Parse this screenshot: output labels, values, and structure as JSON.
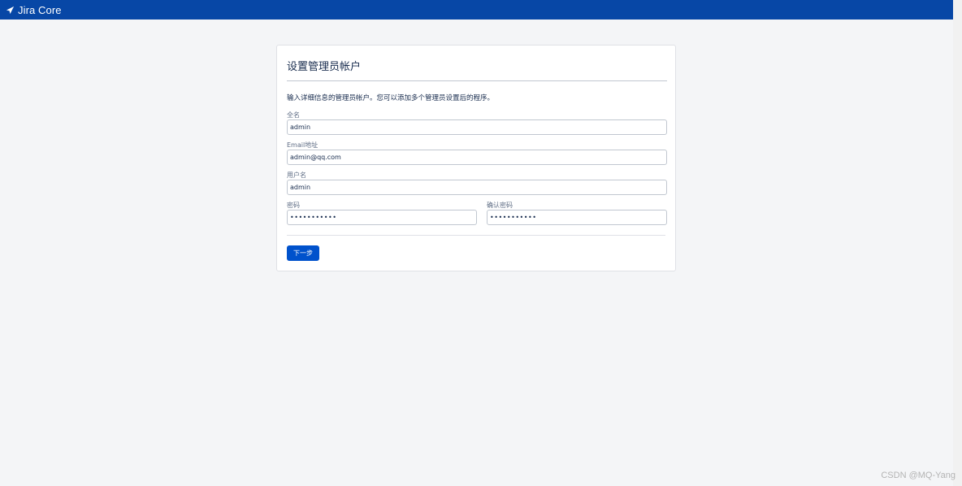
{
  "app": {
    "logo_text": "Jira Core",
    "brand_color": "#0747a6",
    "logo_icon": "jira-arrow-icon"
  },
  "form": {
    "title": "设置管理员帐户",
    "intro": "输入详细信息的管理员帐户。您可以添加多个管理员设置后的程序。",
    "fields": {
      "fullname": {
        "label": "全名",
        "value": "admin"
      },
      "email": {
        "label": "Email地址",
        "value": "admin@qq.com"
      },
      "username": {
        "label": "用户名",
        "value": "admin"
      },
      "password": {
        "label": "密码",
        "value": "•••••••••••"
      },
      "confirm_password": {
        "label": "确认密码",
        "value": "•••••••••••"
      }
    },
    "next_button": "下一步",
    "button_color": "#0052cc"
  },
  "watermark": "CSDN @MQ-Yang"
}
